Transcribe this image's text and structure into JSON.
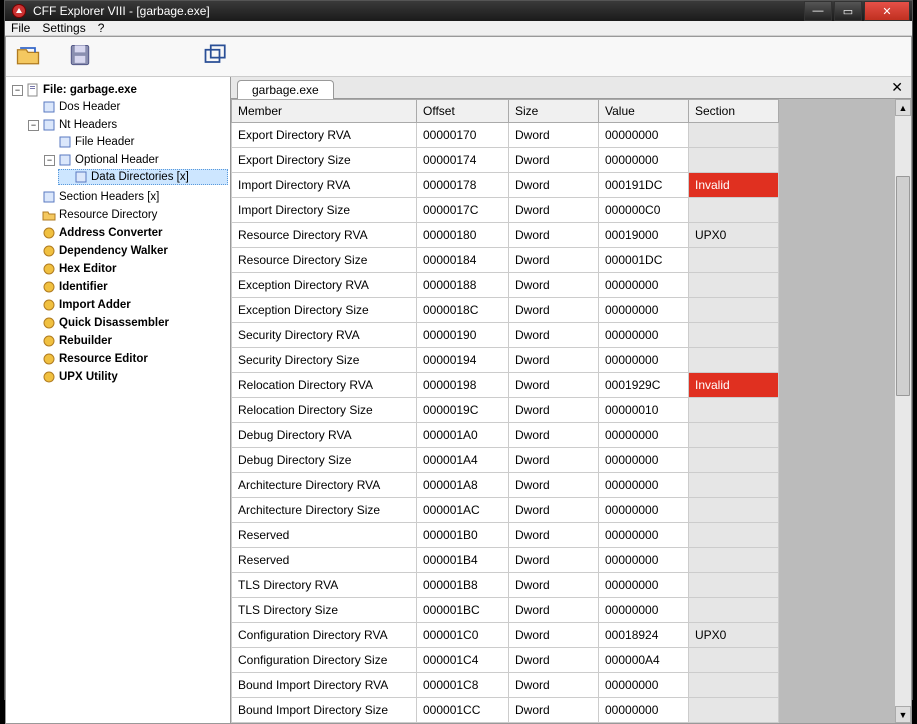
{
  "window": {
    "title": "CFF Explorer VIII - [garbage.exe]"
  },
  "menu": {
    "file": "File",
    "settings": "Settings",
    "help": "?"
  },
  "tabs": {
    "active": "garbage.exe"
  },
  "tree": {
    "root": {
      "label": "File: garbage.exe"
    },
    "items": [
      {
        "label": "Dos Header"
      },
      {
        "label": "Nt Headers"
      },
      {
        "label": "File Header"
      },
      {
        "label": "Optional Header"
      },
      {
        "label": "Data Directories [x]"
      },
      {
        "label": "Section Headers [x]"
      },
      {
        "label": "Resource Directory"
      },
      {
        "label": "Address Converter"
      },
      {
        "label": "Dependency Walker"
      },
      {
        "label": "Hex Editor"
      },
      {
        "label": "Identifier"
      },
      {
        "label": "Import Adder"
      },
      {
        "label": "Quick Disassembler"
      },
      {
        "label": "Rebuilder"
      },
      {
        "label": "Resource Editor"
      },
      {
        "label": "UPX Utility"
      }
    ]
  },
  "grid": {
    "headers": {
      "member": "Member",
      "offset": "Offset",
      "size": "Size",
      "value": "Value",
      "section": "Section"
    },
    "rows": [
      {
        "member": "Export Directory RVA",
        "offset": "00000170",
        "size": "Dword",
        "value": "00000000",
        "section": "",
        "sectClass": "sec"
      },
      {
        "member": "Export Directory Size",
        "offset": "00000174",
        "size": "Dword",
        "value": "00000000",
        "section": "",
        "sectClass": "sec"
      },
      {
        "member": "Import Directory RVA",
        "offset": "00000178",
        "size": "Dword",
        "value": "000191DC",
        "section": "Invalid",
        "sectClass": "invalid"
      },
      {
        "member": "Import Directory Size",
        "offset": "0000017C",
        "size": "Dword",
        "value": "000000C0",
        "section": "",
        "sectClass": "sec"
      },
      {
        "member": "Resource Directory RVA",
        "offset": "00000180",
        "size": "Dword",
        "value": "00019000",
        "section": "UPX0",
        "sectClass": "sec"
      },
      {
        "member": "Resource Directory Size",
        "offset": "00000184",
        "size": "Dword",
        "value": "000001DC",
        "section": "",
        "sectClass": "sec"
      },
      {
        "member": "Exception Directory RVA",
        "offset": "00000188",
        "size": "Dword",
        "value": "00000000",
        "section": "",
        "sectClass": "sec"
      },
      {
        "member": "Exception Directory Size",
        "offset": "0000018C",
        "size": "Dword",
        "value": "00000000",
        "section": "",
        "sectClass": "sec"
      },
      {
        "member": "Security Directory RVA",
        "offset": "00000190",
        "size": "Dword",
        "value": "00000000",
        "section": "",
        "sectClass": "sec"
      },
      {
        "member": "Security Directory Size",
        "offset": "00000194",
        "size": "Dword",
        "value": "00000000",
        "section": "",
        "sectClass": "sec"
      },
      {
        "member": "Relocation Directory RVA",
        "offset": "00000198",
        "size": "Dword",
        "value": "0001929C",
        "section": "Invalid",
        "sectClass": "invalid"
      },
      {
        "member": "Relocation Directory Size",
        "offset": "0000019C",
        "size": "Dword",
        "value": "00000010",
        "section": "",
        "sectClass": "sec"
      },
      {
        "member": "Debug Directory RVA",
        "offset": "000001A0",
        "size": "Dword",
        "value": "00000000",
        "section": "",
        "sectClass": "sec"
      },
      {
        "member": "Debug Directory Size",
        "offset": "000001A4",
        "size": "Dword",
        "value": "00000000",
        "section": "",
        "sectClass": "sec"
      },
      {
        "member": "Architecture Directory RVA",
        "offset": "000001A8",
        "size": "Dword",
        "value": "00000000",
        "section": "",
        "sectClass": "sec"
      },
      {
        "member": "Architecture Directory Size",
        "offset": "000001AC",
        "size": "Dword",
        "value": "00000000",
        "section": "",
        "sectClass": "sec"
      },
      {
        "member": "Reserved",
        "offset": "000001B0",
        "size": "Dword",
        "value": "00000000",
        "section": "",
        "sectClass": "sec"
      },
      {
        "member": "Reserved",
        "offset": "000001B4",
        "size": "Dword",
        "value": "00000000",
        "section": "",
        "sectClass": "sec"
      },
      {
        "member": "TLS Directory RVA",
        "offset": "000001B8",
        "size": "Dword",
        "value": "00000000",
        "section": "",
        "sectClass": "sec"
      },
      {
        "member": "TLS Directory Size",
        "offset": "000001BC",
        "size": "Dword",
        "value": "00000000",
        "section": "",
        "sectClass": "sec"
      },
      {
        "member": "Configuration Directory RVA",
        "offset": "000001C0",
        "size": "Dword",
        "value": "00018924",
        "section": "UPX0",
        "sectClass": "sec"
      },
      {
        "member": "Configuration Directory Size",
        "offset": "000001C4",
        "size": "Dword",
        "value": "000000A4",
        "section": "",
        "sectClass": "sec"
      },
      {
        "member": "Bound Import Directory RVA",
        "offset": "000001C8",
        "size": "Dword",
        "value": "00000000",
        "section": "",
        "sectClass": "sec"
      },
      {
        "member": "Bound Import Directory Size",
        "offset": "000001CC",
        "size": "Dword",
        "value": "00000000",
        "section": "",
        "sectClass": "sec"
      }
    ]
  }
}
